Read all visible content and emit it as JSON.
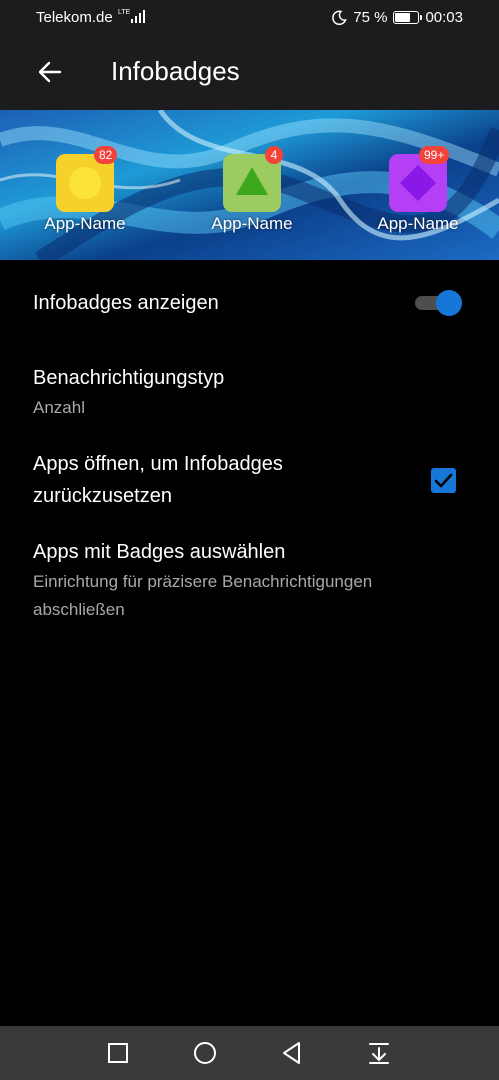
{
  "status_bar": {
    "carrier": "Telekom.de",
    "network": "LTE",
    "battery_percent": "75 %",
    "battery_level": 0.75,
    "time": "00:03"
  },
  "header": {
    "back_icon": "arrow-left-icon",
    "title": "Infobadges"
  },
  "preview": {
    "apps": [
      {
        "name": "App-Name",
        "badge": "82",
        "color": "#f7d12b",
        "shape": "circle"
      },
      {
        "name": "App-Name",
        "badge": "4",
        "color": "#9ccb62",
        "shape": "triangle"
      },
      {
        "name": "App-Name",
        "badge": "99+",
        "color": "#b53ff5",
        "shape": "diamond"
      }
    ]
  },
  "settings": {
    "show_badges": {
      "label": "Infobadges anzeigen",
      "enabled": true
    },
    "notification_type": {
      "label": "Benachrichtigungstyp",
      "value": "Anzahl"
    },
    "reset_on_open": {
      "label_line1": "Apps öffnen, um Infobadges",
      "label_line2": "zurückzusetzen",
      "checked": true
    },
    "select_apps": {
      "label": "Apps mit Badges auswählen",
      "desc_line1": "Einrichtung für präzisere Benachrichtigungen",
      "desc_line2": "abschließen"
    }
  },
  "navigation": [
    "recent-apps-icon",
    "home-icon",
    "back-icon",
    "notification-shade-icon"
  ],
  "colors": {
    "accent": "#1677d8",
    "badge": "#f2423a",
    "bar_background": "#1c1c1e"
  }
}
